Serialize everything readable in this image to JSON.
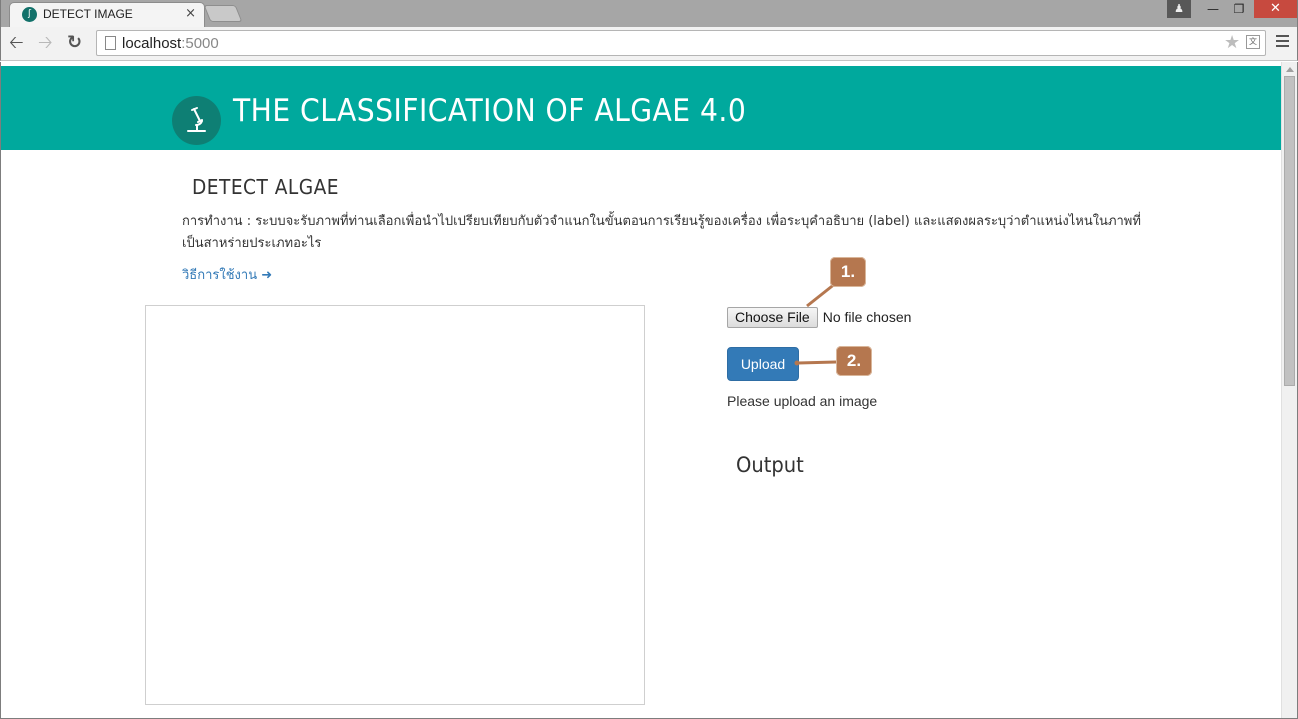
{
  "browser": {
    "tab_title": "DETECT IMAGE",
    "tab_close": "×",
    "url_host": "localhost",
    "url_port": ":5000"
  },
  "header": {
    "title": "THE CLASSIFICATION OF ALGAE 4.0"
  },
  "main": {
    "section_title": "DETECT ALGAE",
    "description": "การทำงาน : ระบบจะรับภาพที่ท่านเลือกเพื่อนำไปเปรียบเทียบกับตัวจำแนกในขั้นตอนการเรียนรู้ของเครื่อง เพื่อระบุคำอธิบาย (label) และแสดงผลระบุว่าตำแหน่งไหนในภาพที่เป็นสาหร่ายประเภทอะไร",
    "howto_link": "วิธีการใช้งาน",
    "choose_file_label": "Choose File",
    "no_file_text": "No file chosen",
    "upload_label": "Upload",
    "status_text": "Please upload an image",
    "output_title": "Output"
  },
  "callouts": {
    "step1": "1.",
    "step2": "2."
  },
  "colors": {
    "banner": "#00a99d",
    "logo_circle": "#0e7f74",
    "primary_button": "#337ab7",
    "link": "#337ab7",
    "callout": "#b5774f",
    "window_close": "#c74a3f"
  },
  "icons": [
    "microscope-icon",
    "arrow-right-icon",
    "back-arrow-icon",
    "forward-arrow-icon",
    "reload-icon",
    "page-icon",
    "star-icon",
    "translate-icon",
    "menu-icon"
  ]
}
